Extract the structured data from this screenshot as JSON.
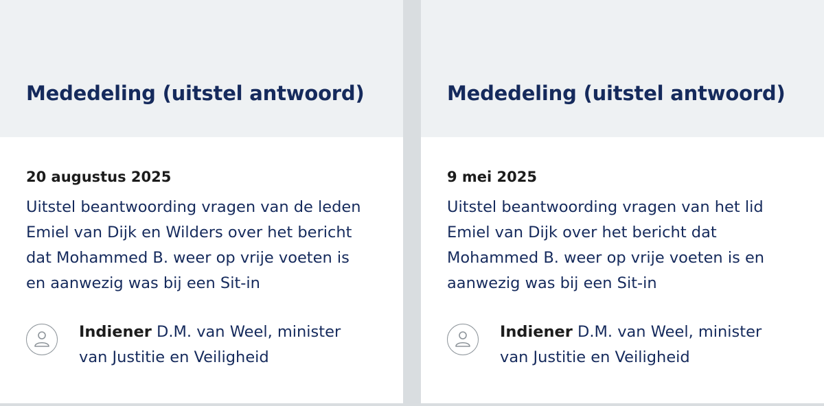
{
  "cards": [
    {
      "title": "Mededeling (uitstel antwoord)",
      "date": "20 augustus 2025",
      "description_lines": [
        "Uitstel beantwoording vragen van de leden",
        "Emiel van Dijk en Wilders over het bericht",
        "dat Mohammed B. weer op vrije voeten is",
        "en aanwezig was bij een Sit-in"
      ],
      "submitter_label": "Indiener",
      "submitter_lines": [
        "D.M. van Weel, minister",
        "van Justitie en Veiligheid"
      ],
      "avatar_icon": "user-icon"
    },
    {
      "title": "Mededeling (uitstel antwoord)",
      "date": "9 mei 2025",
      "description_lines": [
        "Uitstel beantwoording vragen van het lid",
        "Emiel van Dijk over het bericht dat",
        "Mohammed B. weer op vrije voeten is en",
        "aanwezig was bij een Sit-in"
      ],
      "submitter_label": "Indiener",
      "submitter_lines": [
        "D.M. van Weel, minister",
        "van Justitie en Veiligheid"
      ],
      "avatar_icon": "user-icon"
    }
  ],
  "colors": {
    "title": "#152a5c",
    "header_bg": "#eef1f3",
    "divider": "#d9dde0"
  }
}
